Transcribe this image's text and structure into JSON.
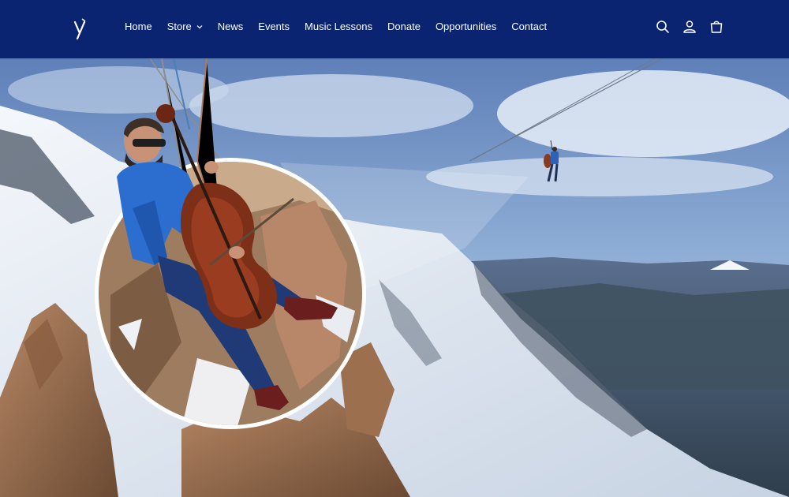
{
  "header": {
    "logo_icon": "logo-mark",
    "nav": [
      {
        "label": "Home"
      },
      {
        "label": "Store",
        "has_dropdown": true
      },
      {
        "label": "News"
      },
      {
        "label": "Events"
      },
      {
        "label": "Music Lessons"
      },
      {
        "label": "Donate"
      },
      {
        "label": "Opportunities"
      },
      {
        "label": "Contact"
      }
    ],
    "icons": [
      "search-icon",
      "account-icon",
      "cart-icon"
    ],
    "background_color": "#0b2471"
  },
  "hero": {
    "image": "cellist suspended on a zipline above snowy mountains, with circular close-up inset"
  }
}
